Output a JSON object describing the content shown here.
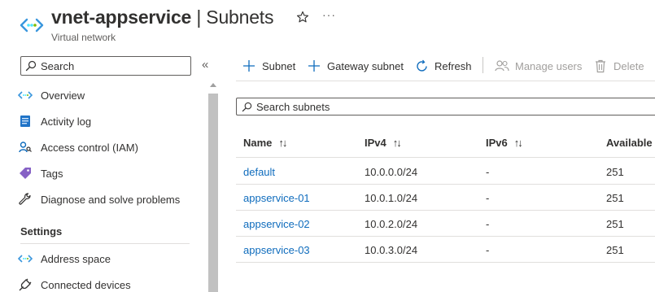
{
  "header": {
    "title_resource": "vnet-appservice",
    "title_separator": " | ",
    "title_page": "Subnets",
    "subtitle": "Virtual network",
    "more": "···"
  },
  "sidebar": {
    "search_placeholder": "Search",
    "collapse": "«",
    "items": [
      {
        "label": "Overview",
        "icon": "vnet-icon"
      },
      {
        "label": "Activity log",
        "icon": "activity-log-icon"
      },
      {
        "label": "Access control (IAM)",
        "icon": "iam-icon"
      },
      {
        "label": "Tags",
        "icon": "tag-icon"
      },
      {
        "label": "Diagnose and solve problems",
        "icon": "wrench-icon"
      }
    ],
    "settings_title": "Settings",
    "settings_items": [
      {
        "label": "Address space",
        "icon": "address-space-icon"
      },
      {
        "label": "Connected devices",
        "icon": "plug-icon"
      }
    ]
  },
  "toolbar": {
    "subnet": "Subnet",
    "gateway_subnet": "Gateway subnet",
    "refresh": "Refresh",
    "manage_users": "Manage users",
    "delete": "Delete"
  },
  "search": {
    "placeholder": "Search subnets"
  },
  "table": {
    "columns": [
      "Name",
      "IPv4",
      "IPv6",
      "Available I"
    ],
    "sort_glyph": "↑↓",
    "rows": [
      {
        "name": "default",
        "ipv4": "10.0.0.0/24",
        "ipv6": "-",
        "available": "251"
      },
      {
        "name": "appservice-01",
        "ipv4": "10.0.1.0/24",
        "ipv6": "-",
        "available": "251"
      },
      {
        "name": "appservice-02",
        "ipv4": "10.0.2.0/24",
        "ipv6": "-",
        "available": "251"
      },
      {
        "name": "appservice-03",
        "ipv4": "10.0.3.0/24",
        "ipv6": "-",
        "available": "251"
      }
    ]
  },
  "colors": {
    "accent": "#0f6cbd",
    "text": "#323130",
    "disabled": "#a19f9d",
    "divider": "#e1dfdd"
  }
}
